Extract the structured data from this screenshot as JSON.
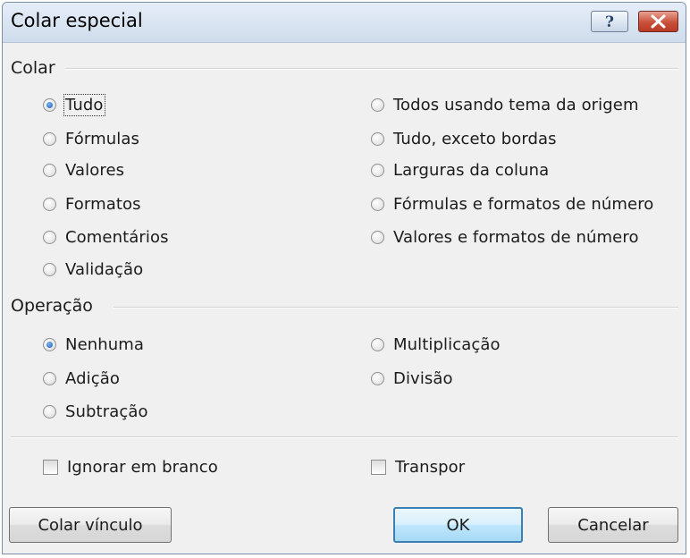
{
  "window": {
    "title": "Colar especial",
    "help_icon": "question-icon",
    "close_icon": "close-icon"
  },
  "colar": {
    "heading": "Colar",
    "options": [
      {
        "label": "Tudo",
        "checked": true
      },
      {
        "label": "Fórmulas",
        "checked": false
      },
      {
        "label": "Valores",
        "checked": false
      },
      {
        "label": "Formatos",
        "checked": false
      },
      {
        "label": "Comentários",
        "checked": false
      },
      {
        "label": "Validação",
        "checked": false
      },
      {
        "label": "Todos usando tema da origem",
        "checked": false
      },
      {
        "label": "Tudo, exceto bordas",
        "checked": false
      },
      {
        "label": "Larguras da coluna",
        "checked": false
      },
      {
        "label": "Fórmulas e formatos de número",
        "checked": false
      },
      {
        "label": "Valores e formatos de número",
        "checked": false
      }
    ]
  },
  "operacao": {
    "heading": "Operação",
    "options": [
      {
        "label": "Nenhuma",
        "checked": true
      },
      {
        "label": "Adição",
        "checked": false
      },
      {
        "label": "Subtração",
        "checked": false
      },
      {
        "label": "Multiplicação",
        "checked": false
      },
      {
        "label": "Divisão",
        "checked": false
      }
    ]
  },
  "checkboxes": {
    "ignorar_em_branco": {
      "label": "Ignorar em branco",
      "checked": false
    },
    "transpor": {
      "label": "Transpor",
      "checked": false
    }
  },
  "buttons": {
    "colar_vinculo": "Colar vínculo",
    "ok": "OK",
    "cancelar": "Cancelar"
  }
}
